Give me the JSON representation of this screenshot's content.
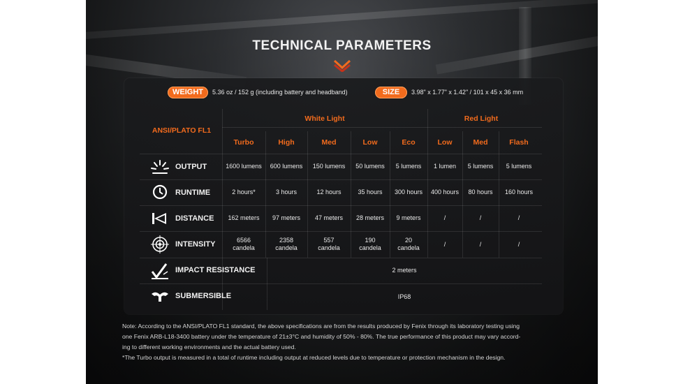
{
  "title": "TECHNICAL PARAMETERS",
  "weight": {
    "label": "WEIGHT",
    "value": "5.36 oz / 152 g (including battery and headband)"
  },
  "size": {
    "label": "SIZE",
    "value": "3.98\" x 1.77\" x 1.42\" / 101 x 45 x 36 mm"
  },
  "table": {
    "standard": "ANSI/PLATO FL1",
    "group_white": "White Light",
    "group_red": "Red Light",
    "modes": [
      "Turbo",
      "High",
      "Med",
      "Low",
      "Eco",
      "Low",
      "Med",
      "Flash"
    ],
    "rows": [
      {
        "label": "OUTPUT",
        "icon": "burst-icon",
        "values": [
          "1600 lumens",
          "600 lumens",
          "150 lumens",
          "50 lumens",
          "5 lumens",
          "1 lumen",
          "5 lumens",
          "5 lumens"
        ]
      },
      {
        "label": "RUNTIME",
        "icon": "clock-icon",
        "values": [
          "2 hours*",
          "3 hours",
          "12 hours",
          "35 hours",
          "300 hours",
          "400 hours",
          "80 hours",
          "160 hours"
        ]
      },
      {
        "label": "DISTANCE",
        "icon": "beam-distance-icon",
        "values": [
          "162 meters",
          "97 meters",
          "47 meters",
          "28 meters",
          "9 meters",
          "/",
          "/",
          "/"
        ]
      },
      {
        "label": "INTENSITY",
        "icon": "target-icon",
        "values": [
          "6566\ncandela",
          "2358\ncandela",
          "557\ncandela",
          "190\ncandela",
          "20\ncandela",
          "/",
          "/",
          "/"
        ]
      }
    ],
    "impact": {
      "label": "IMPACT RESISTANCE",
      "icon": "impact-icon",
      "value": "2 meters"
    },
    "submersible": {
      "label": "SUBMERSIBLE",
      "icon": "water-splash-icon",
      "value": "IP68"
    }
  },
  "note": {
    "line1": "Note: According to the ANSI/PLATO FL1 standard, the above specifications are from the results produced by Fenix through its laboratory testing using",
    "line2": "one Fenix ARB-L18-3400 battery under the temperature of 21±3°C and humidity of 50% - 80%. The true performance of this product may vary accord-",
    "line3": "ing to different working environments and the actual battery used.",
    "line4": "*The Turbo output is measured in a total of runtime including output at reduced levels due to temperature or protection mechanism in the design."
  },
  "colors": {
    "accent": "#f26b1d",
    "background": "#1b1c1e",
    "text": "#eaeaea"
  }
}
